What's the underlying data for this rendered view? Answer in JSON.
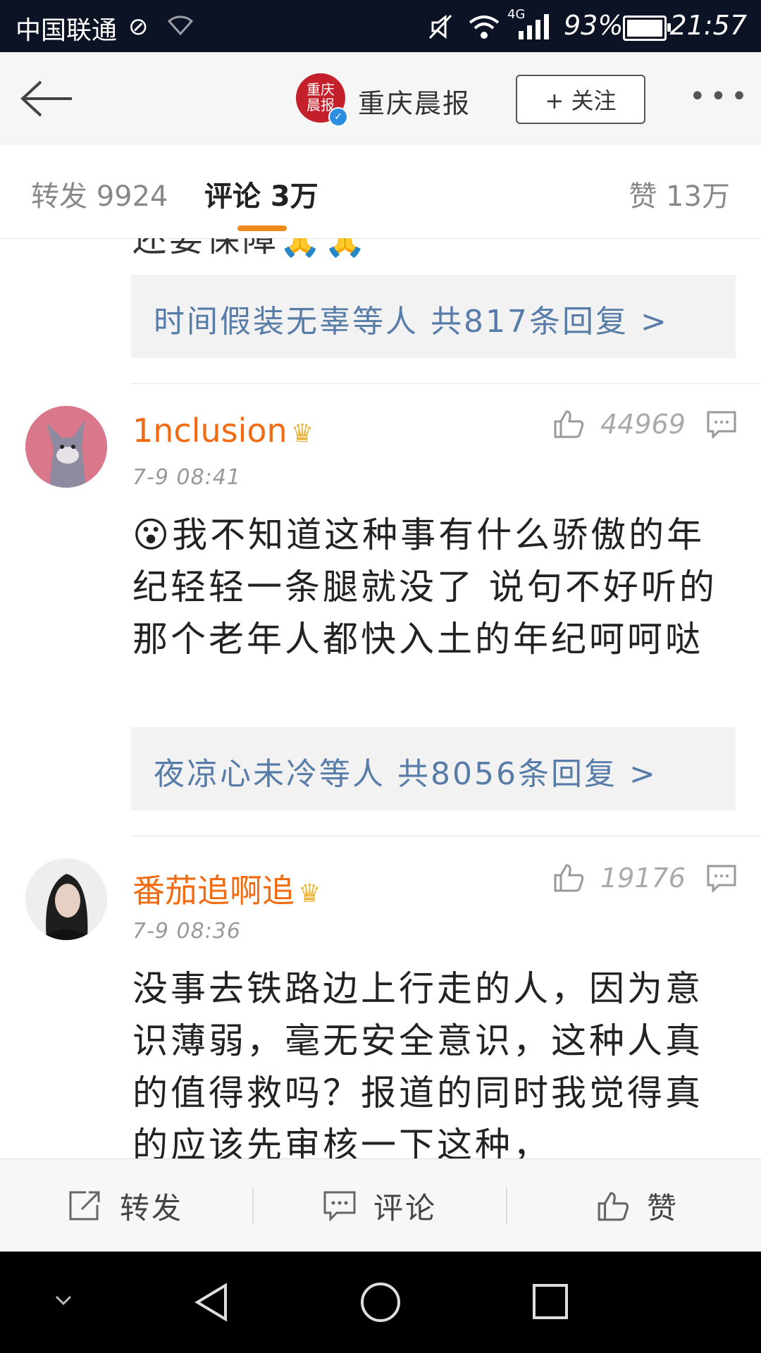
{
  "status_bar": {
    "carrier": "中国联通",
    "network": "4G",
    "battery_percent": "93%",
    "battery_level": 0.93,
    "time": "21:57"
  },
  "header": {
    "logo_text": "重庆晨报",
    "title": "重庆晨报",
    "follow_label": "+ 关注"
  },
  "tabs": [
    {
      "label": "转发 9924"
    },
    {
      "label": "评论 3万",
      "active": true
    },
    {
      "label": "赞 13万"
    }
  ],
  "top_reply": {
    "partial_text": "还要保障🙏🙏",
    "summary": "时间假装无辜等人  共817条回复 >"
  },
  "comments": [
    {
      "username": "1nclusion",
      "time": "7-9 08:41",
      "likes": "44969",
      "text": "😮我不知道这种事有什么骄傲的年纪轻轻一条腿就没了 说句不好听的 那个老年人都快入土的年纪呵呵哒",
      "reply_summary": "夜凉心未冷等人  共8056条回复 >"
    },
    {
      "username": "番茄追啊追",
      "time": "7-9 08:36",
      "likes": "19176",
      "text": "没事去铁路边上行走的人，因为意识薄弱，毫无安全意识，这种人真的值得救吗？报道的同时我觉得真的应该先审核一下这种，"
    }
  ],
  "action_bar": {
    "repost": "转发",
    "comment": "评论",
    "like": "赞"
  },
  "colors": {
    "accent": "#f08a1d",
    "username": "#f06b12",
    "reply_link": "#587ca8",
    "status_bar_bg": "#0c1324"
  }
}
